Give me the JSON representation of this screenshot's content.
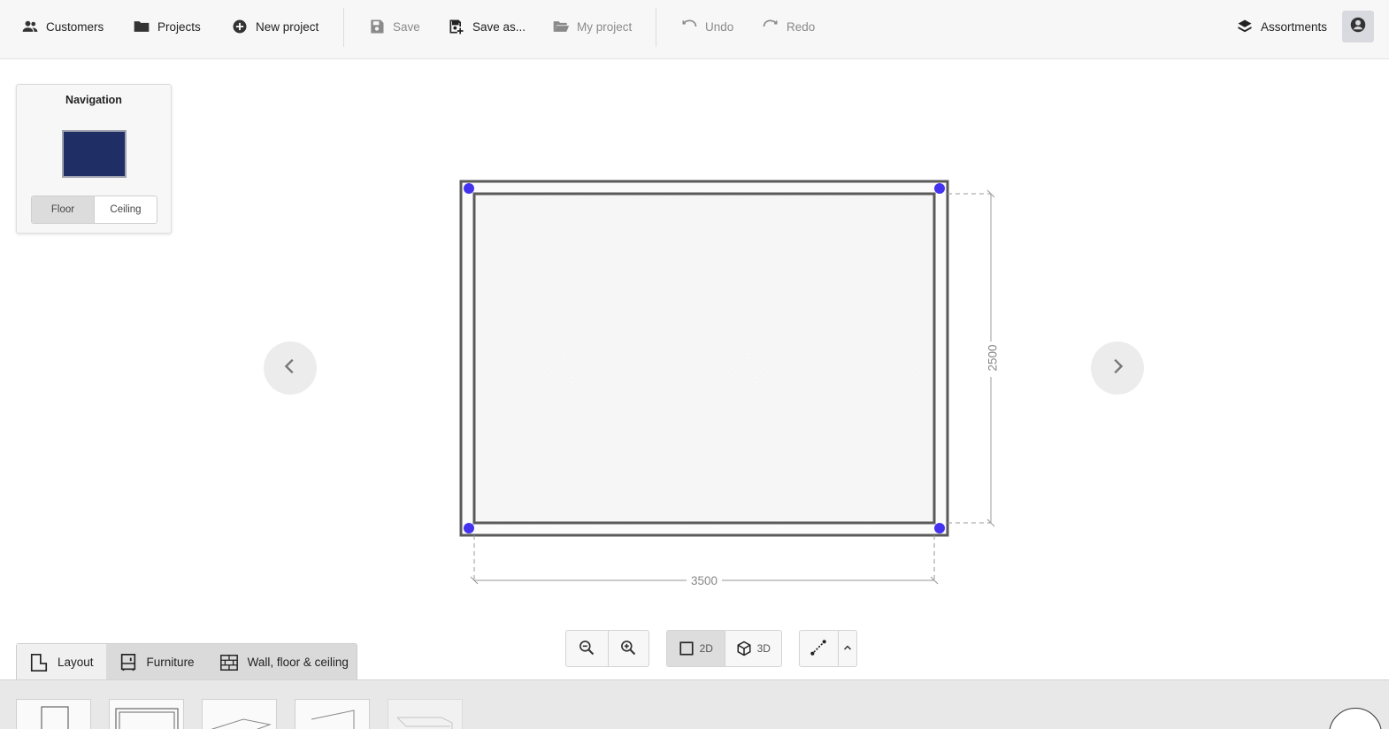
{
  "toolbar": {
    "customers": "Customers",
    "projects": "Projects",
    "new_project": "New project",
    "save": "Save",
    "save_as": "Save as...",
    "my_project": "My project",
    "undo": "Undo",
    "redo": "Redo",
    "assortments": "Assortments"
  },
  "navigation": {
    "title": "Navigation",
    "floor": "Floor",
    "ceiling": "Ceiling",
    "active": "Floor",
    "preview_color": "#1f2f66"
  },
  "plan": {
    "width_label": "3500",
    "height_label": "2500",
    "handle_color": "#4433ee"
  },
  "view_controls": {
    "mode_2d": "2D",
    "mode_3d": "3D",
    "active_mode": "2D"
  },
  "tabs": [
    {
      "label": "Layout",
      "icon": "layout-icon",
      "active": true
    },
    {
      "label": "Furniture",
      "icon": "cabinet-icon",
      "active": false
    },
    {
      "label": "Wall, floor & ceiling",
      "icon": "brick-wall-icon",
      "active": false
    }
  ]
}
